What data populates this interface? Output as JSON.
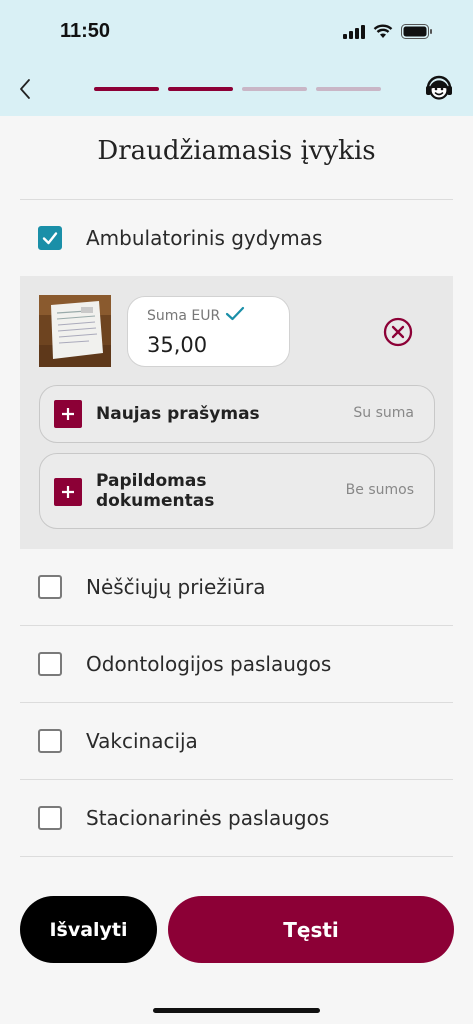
{
  "status_bar": {
    "time": "11:50"
  },
  "header": {
    "progress": {
      "total_steps": 4,
      "completed_steps": 2
    },
    "colors": {
      "active": "#8c0036",
      "inactive": "#c9b6c6"
    }
  },
  "title": "Draudžiamasis įvykis",
  "categories": [
    {
      "label": "Ambulatorinis gydymas",
      "checked": true
    },
    {
      "label": "Nėščiųjų priežiūra",
      "checked": false
    },
    {
      "label": "Odontologijos paslaugos",
      "checked": false
    },
    {
      "label": "Vakcinacija",
      "checked": false
    },
    {
      "label": "Stacionarinės paslaugos",
      "checked": false
    }
  ],
  "claim": {
    "amount_label": "Suma EUR",
    "amount_value": "35,00",
    "new_request": {
      "title": "Naujas prašymas",
      "hint": "Su suma"
    },
    "extra_document": {
      "title_line1": "Papildomas",
      "title_line2": "dokumentas",
      "hint": "Be sumos"
    }
  },
  "buttons": {
    "clear": "Išvalyti",
    "continue": "Tęsti"
  },
  "colors": {
    "brand": "#8c0036",
    "check": "#1a8fa8",
    "header_bg": "#d9f0f5"
  }
}
